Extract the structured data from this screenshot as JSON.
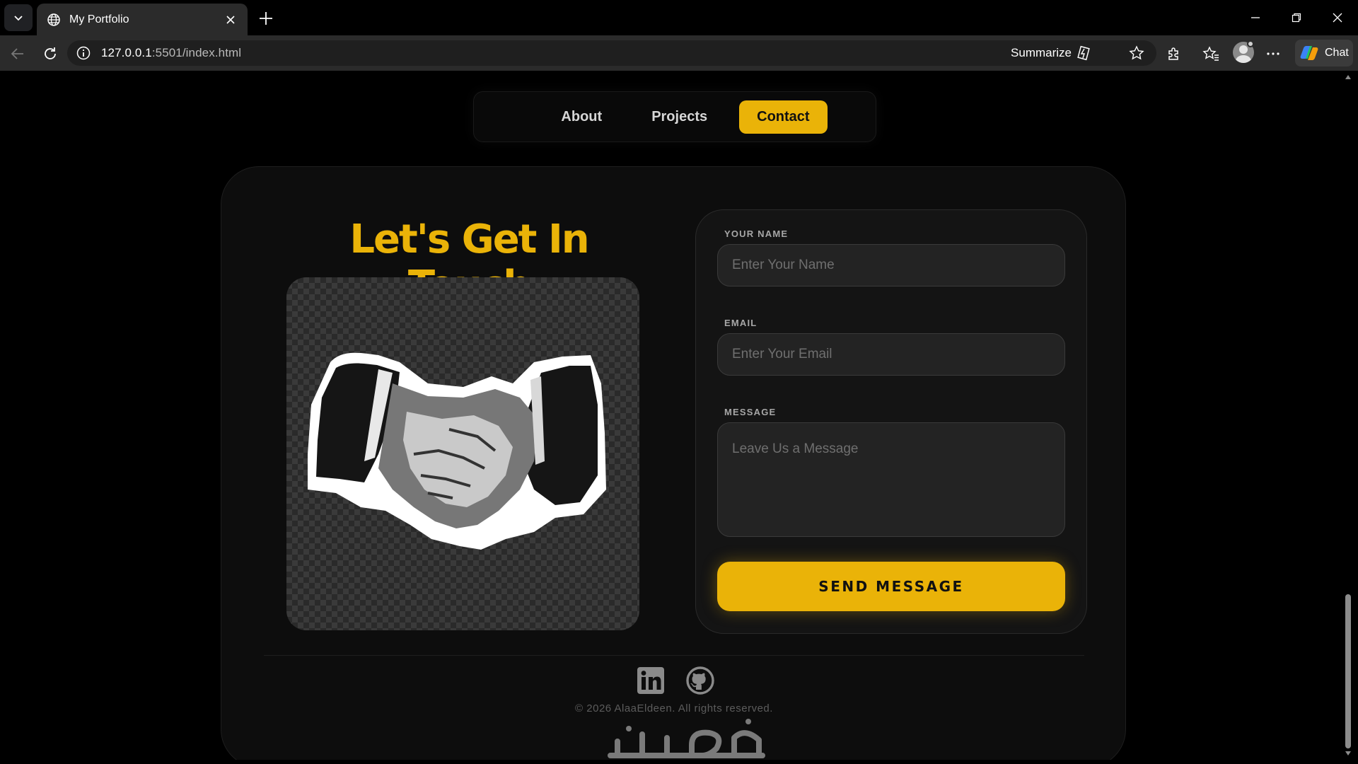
{
  "browser": {
    "tab_title": "My Portfolio",
    "url_host": "127.0.0.1",
    "url_rest": ":5501/index.html",
    "summarize_label": "Summarize",
    "chat_label": "Chat"
  },
  "nav": {
    "items": [
      {
        "label": "About",
        "active": false
      },
      {
        "label": "Projects",
        "active": false
      },
      {
        "label": "Contact",
        "active": true
      }
    ]
  },
  "contact": {
    "heading": "Let's Get In Touch",
    "illustration": "handshake-illustration",
    "form": {
      "name_label": "YOUR NAME",
      "name_placeholder": "Enter Your Name",
      "email_label": "EMAIL",
      "email_placeholder": "Enter Your Email",
      "message_label": "MESSAGE",
      "message_placeholder": "Leave Us a Message",
      "submit_label": "SEND MESSAGE"
    }
  },
  "footer": {
    "social": [
      "linkedin-icon",
      "github-icon"
    ],
    "copyright": "© 2026 AlaaEldeen. All rights reserved.",
    "watermark": "خمسات"
  },
  "colors": {
    "accent": "#eab308",
    "page_bg": "#000000",
    "card_bg": "#0d0d0d",
    "input_bg": "#232323"
  }
}
